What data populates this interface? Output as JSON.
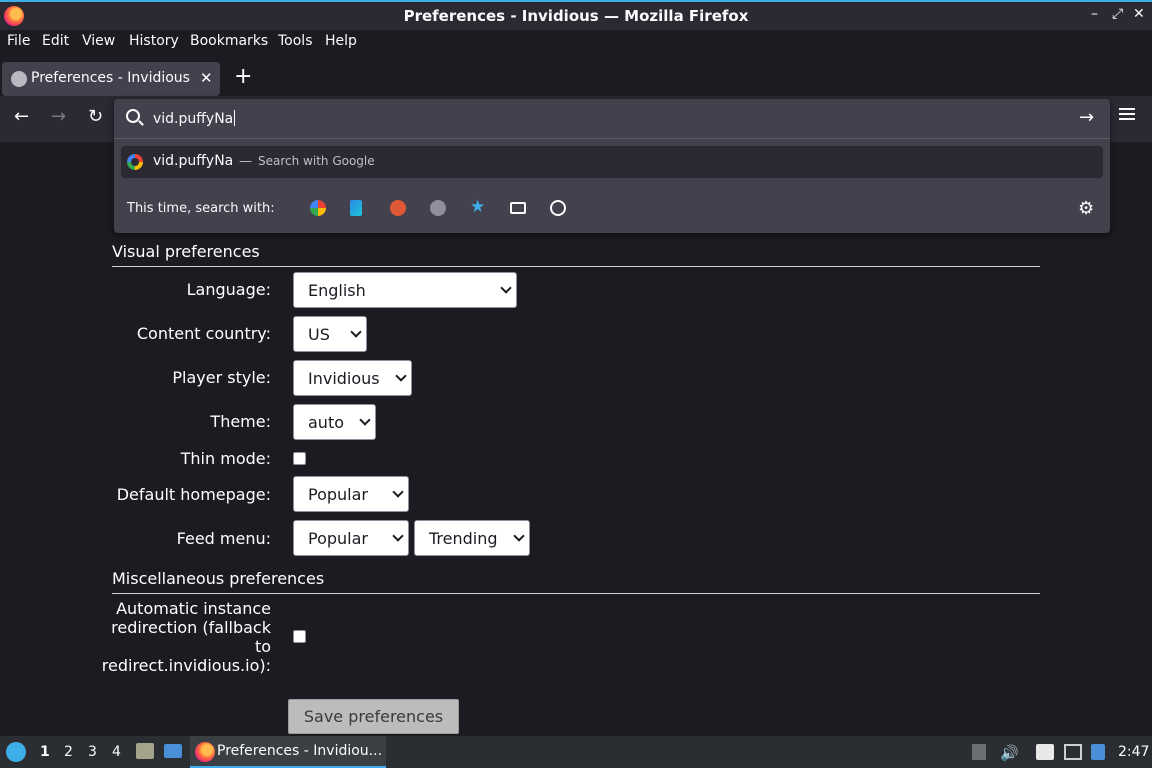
{
  "window": {
    "title": "Preferences - Invidious — Mozilla Firefox"
  },
  "menubar": [
    "File",
    "Edit",
    "View",
    "History",
    "Bookmarks",
    "Tools",
    "Help"
  ],
  "tab": {
    "title": "Preferences - Invidious"
  },
  "urlbar": {
    "value": "vid.puffyNa",
    "suggestion_term": "vid.puffyNa",
    "suggestion_separator": "—",
    "suggestion_action": "Search with Google",
    "oneoff_label": "This time, search with:"
  },
  "visual": {
    "heading": "Visual preferences",
    "language_label": "Language:",
    "language_value": "English",
    "country_label": "Content country:",
    "country_value": "US",
    "player_label": "Player style:",
    "player_value": "Invidious",
    "theme_label": "Theme:",
    "theme_value": "auto",
    "thin_label": "Thin mode:",
    "homepage_label": "Default homepage:",
    "homepage_value": "Popular",
    "feed_label": "Feed menu:",
    "feed_value_1": "Popular",
    "feed_value_2": "Trending"
  },
  "misc": {
    "heading": "Miscellaneous preferences",
    "redirect_label_1": "Automatic instance",
    "redirect_label_2": "redirection (fallback",
    "redirect_label_3": "to",
    "redirect_label_4": "redirect.invidious.io):"
  },
  "save_button": "Save preferences",
  "taskbar": {
    "workspaces": [
      "1",
      "2",
      "3",
      "4"
    ],
    "task_title": "Preferences - Invidiou...",
    "clock": "2:47"
  },
  "colors": {
    "accent": "#3daee9",
    "content_bg": "#1c1b22",
    "toolbar_bg": "#2b2a33",
    "urlbar_bg": "#42414d"
  }
}
